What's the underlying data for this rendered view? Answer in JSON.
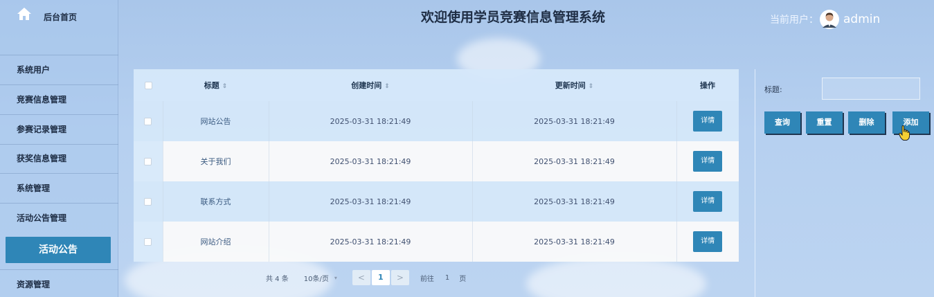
{
  "sidebar": {
    "home_label": "后台首页",
    "items": [
      {
        "label": "系统用户"
      },
      {
        "label": "竞赛信息管理"
      },
      {
        "label": "参赛记录管理"
      },
      {
        "label": "获奖信息管理"
      },
      {
        "label": "系统管理"
      },
      {
        "label": "活动公告管理"
      }
    ],
    "active_sub": "活动公告",
    "last_item": "资源管理"
  },
  "header": {
    "title": "欢迎使用学员竞赛信息管理系统",
    "user_label": "当前用户：",
    "user_name": "admin"
  },
  "table": {
    "columns": {
      "title": "标题",
      "created": "创建时间",
      "updated": "更新时间",
      "actions": "操作"
    },
    "detail_label": "详情",
    "rows": [
      {
        "title": "网站公告",
        "created": "2025-03-31 18:21:49",
        "updated": "2025-03-31 18:21:49"
      },
      {
        "title": "关于我们",
        "created": "2025-03-31 18:21:49",
        "updated": "2025-03-31 18:21:49"
      },
      {
        "title": "联系方式",
        "created": "2025-03-31 18:21:49",
        "updated": "2025-03-31 18:21:49"
      },
      {
        "title": "网站介绍",
        "created": "2025-03-31 18:21:49",
        "updated": "2025-03-31 18:21:49"
      }
    ]
  },
  "pagination": {
    "total": "共 4 条",
    "page_size": "10条/页",
    "prev": "<",
    "current": "1",
    "next": ">",
    "goto_label": "前往",
    "goto_value": "1",
    "page_suffix": "页"
  },
  "filter": {
    "title_label": "标题:",
    "title_value": "",
    "query": "查询",
    "reset": "重置",
    "delete": "删除",
    "add": "添加"
  },
  "colors": {
    "accent": "#2f86b7",
    "background": "#b6d0f0"
  }
}
